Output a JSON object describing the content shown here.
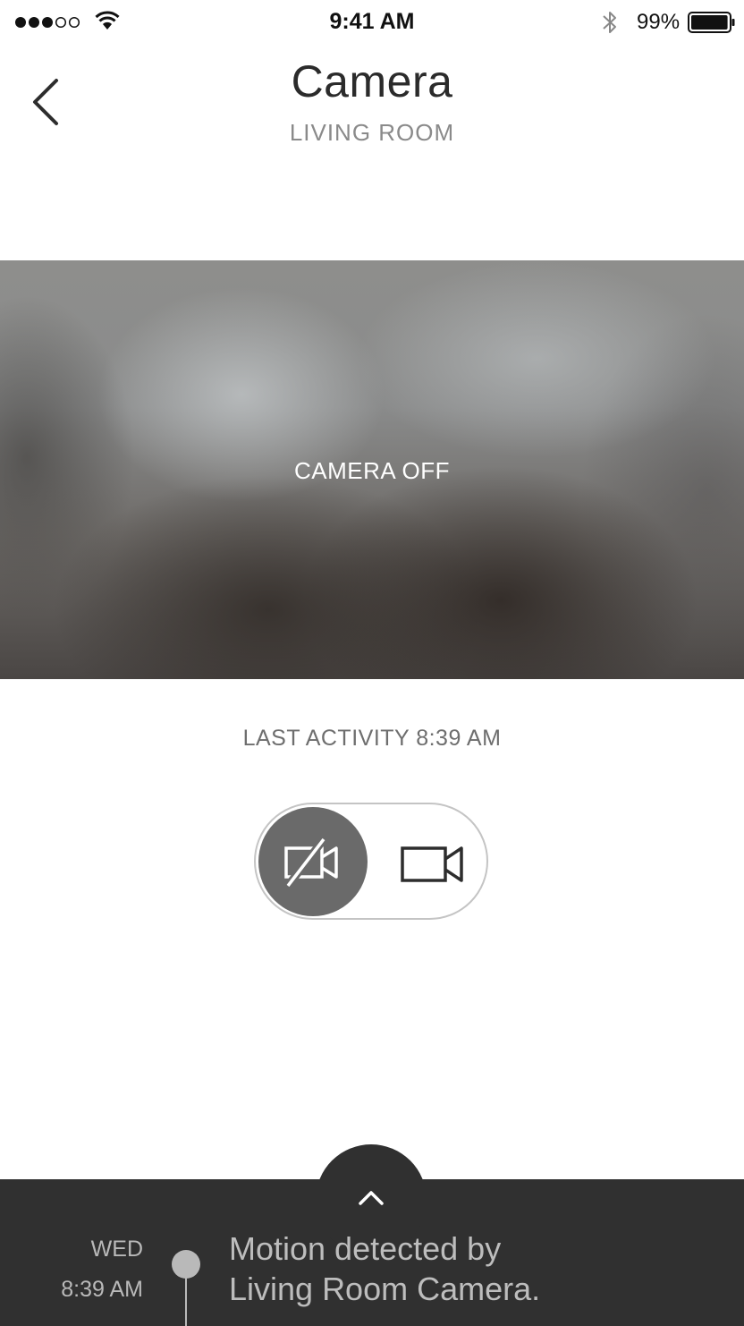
{
  "status_bar": {
    "time": "9:41 AM",
    "battery_percent": "99%",
    "signal_bars": 3,
    "signal_total": 5,
    "battery_level": 0.99
  },
  "header": {
    "title": "Camera",
    "subtitle": "LIVING ROOM",
    "back_icon": "chevron-left-icon"
  },
  "camera": {
    "status_label": "CAMERA OFF",
    "last_activity": "LAST ACTIVITY 8:39 AM"
  },
  "toggle": {
    "selected": "off",
    "off_icon": "video-off-icon",
    "on_icon": "video-camera-icon"
  },
  "activity": {
    "expand_icon": "chevron-up-icon",
    "day": "WED",
    "time": "8:39 AM",
    "line1": "Motion detected by",
    "line2": "Living Room Camera."
  },
  "colors": {
    "drawer_background": "#303030",
    "toggle_active": "#6a6a6a"
  }
}
